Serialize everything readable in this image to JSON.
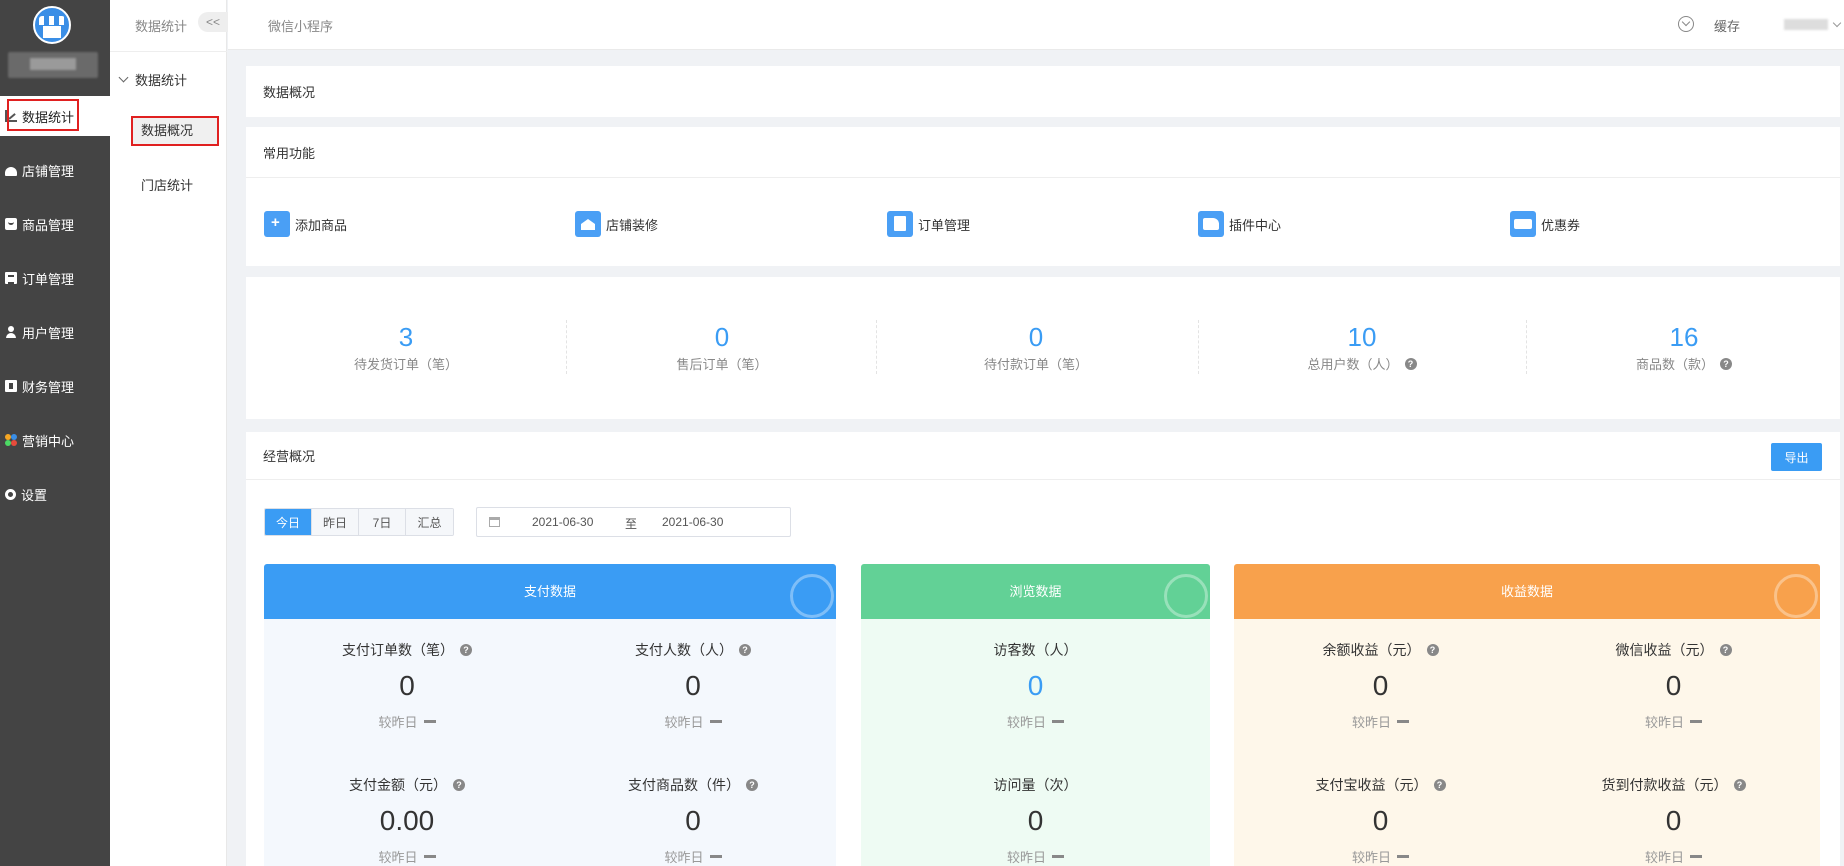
{
  "sidebar": {
    "items": [
      {
        "label": "数据统计",
        "icon": "chart-icon"
      },
      {
        "label": "店铺管理",
        "icon": "store-icon"
      },
      {
        "label": "商品管理",
        "icon": "goods-icon"
      },
      {
        "label": "订单管理",
        "icon": "order-icon"
      },
      {
        "label": "用户管理",
        "icon": "user-icon"
      },
      {
        "label": "财务管理",
        "icon": "finance-icon"
      },
      {
        "label": "营销中心",
        "icon": "marketing-icon"
      },
      {
        "label": "设置",
        "icon": "gear-icon"
      }
    ]
  },
  "subnav": {
    "title": "数据统计",
    "collapse": "<<",
    "group": "数据统计",
    "items": [
      "数据概况",
      "门店统计"
    ]
  },
  "topbar": {
    "breadcrumb": "微信小程序",
    "cache": "缓存"
  },
  "overview": {
    "title": "数据概况"
  },
  "common": {
    "title": "常用功能",
    "items": [
      {
        "label": "添加商品",
        "icon": "add-goods-icon"
      },
      {
        "label": "店铺装修",
        "icon": "store-decor-icon"
      },
      {
        "label": "订单管理",
        "icon": "order-manage-icon"
      },
      {
        "label": "插件中心",
        "icon": "plugin-icon"
      },
      {
        "label": "优惠券",
        "icon": "coupon-icon"
      }
    ]
  },
  "stats": [
    {
      "value": "3",
      "label": "待发货订单（笔）",
      "help": false
    },
    {
      "value": "0",
      "label": "售后订单（笔）",
      "help": false
    },
    {
      "value": "0",
      "label": "待付款订单（笔）",
      "help": false
    },
    {
      "value": "10",
      "label": "总用户数（人）",
      "help": true
    },
    {
      "value": "16",
      "label": "商品数（款）",
      "help": true
    }
  ],
  "business": {
    "title": "经营概况",
    "export": "导出",
    "ranges": [
      "今日",
      "昨日",
      "7日",
      "汇总"
    ],
    "active_range": 0,
    "start_date": "2021-06-30",
    "date_sep": "至",
    "end_date": "2021-06-30"
  },
  "panels": {
    "pay": {
      "title": "支付数据",
      "color": "#3a9cf4",
      "bg": "#f4f8fd",
      "cells": [
        {
          "label": "支付订单数（笔）",
          "value": "0",
          "compare": "较昨日"
        },
        {
          "label": "支付人数（人）",
          "value": "0",
          "compare": "较昨日"
        },
        {
          "label": "支付金额（元）",
          "value": "0.00",
          "compare": "较昨日"
        },
        {
          "label": "支付商品数（件）",
          "value": "0",
          "compare": "较昨日"
        }
      ]
    },
    "browse": {
      "title": "浏览数据",
      "color": "#62d196",
      "bg": "#eefbf3",
      "cells": [
        {
          "label": "访客数（人）",
          "value": "0",
          "compare": "较昨日"
        },
        {
          "label": "访问量（次）",
          "value": "0",
          "compare": "较昨日"
        }
      ]
    },
    "income": {
      "title": "收益数据",
      "color": "#f8a14c",
      "bg": "#fef7ea",
      "cells": [
        {
          "label": "余额收益（元）",
          "value": "0",
          "compare": "较昨日"
        },
        {
          "label": "微信收益（元）",
          "value": "0",
          "compare": "较昨日"
        },
        {
          "label": "支付宝收益（元）",
          "value": "0",
          "compare": "较昨日"
        },
        {
          "label": "货到付款收益（元）",
          "value": "0",
          "compare": "较昨日"
        }
      ]
    }
  }
}
